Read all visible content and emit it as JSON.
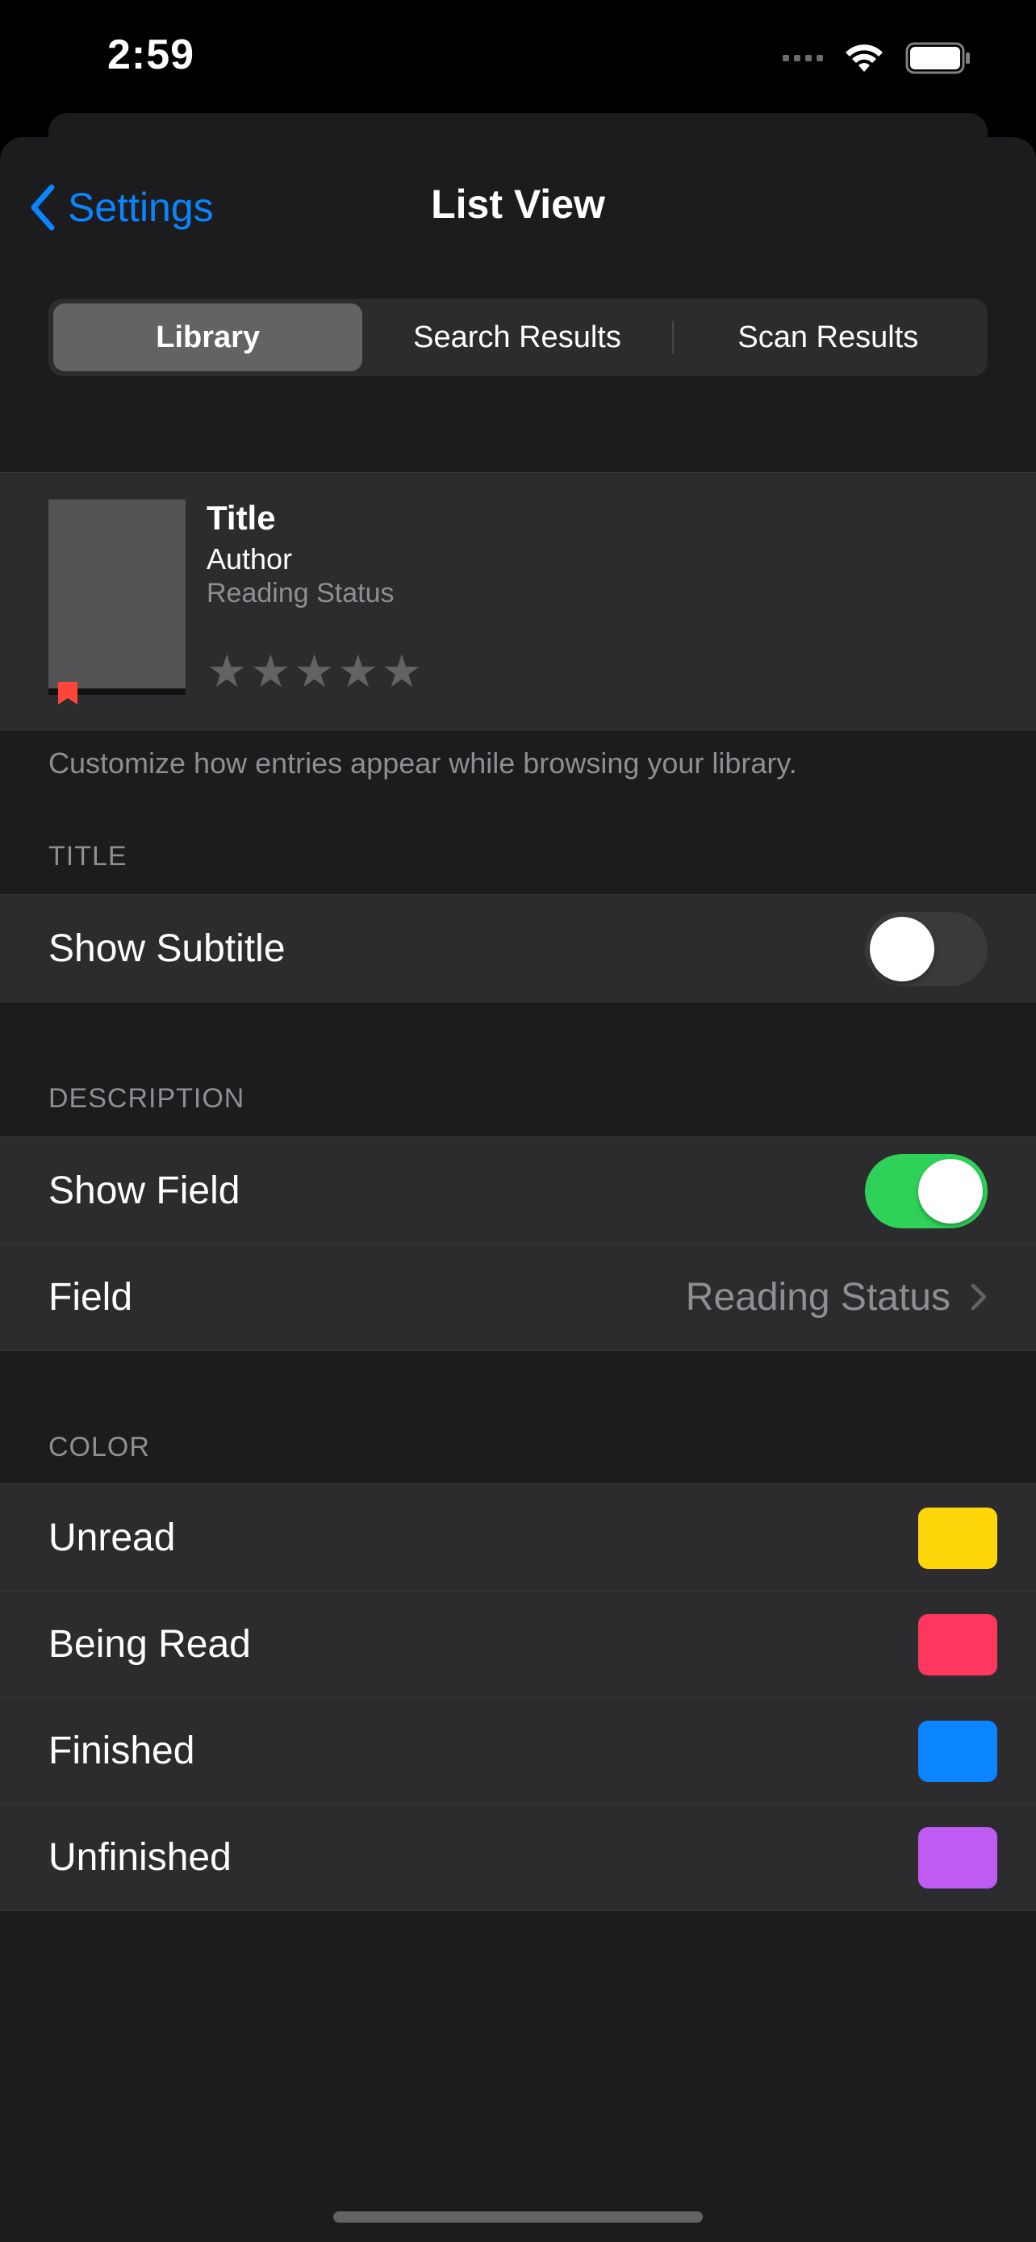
{
  "status_bar": {
    "time": "2:59"
  },
  "nav": {
    "back_label": "Settings",
    "title": "List View"
  },
  "segments": [
    "Library",
    "Search Results",
    "Scan Results"
  ],
  "selected_segment": "Library",
  "preview": {
    "title": "Title",
    "author": "Author",
    "status": "Reading Status",
    "rating_stars": 5,
    "bookmark_color": "#ff453a"
  },
  "footer_note": "Customize how entries appear while browsing your library.",
  "title_section": {
    "header": "TITLE",
    "show_subtitle_label": "Show Subtitle",
    "show_subtitle_on": false
  },
  "description_section": {
    "header": "DESCRIPTION",
    "show_field_label": "Show Field",
    "show_field_on": true,
    "field_label": "Field",
    "field_value": "Reading Status"
  },
  "color_section": {
    "header": "COLOR",
    "items": [
      {
        "label": "Unread",
        "color": "#ffd60a"
      },
      {
        "label": "Being Read",
        "color": "#ff375f"
      },
      {
        "label": "Finished",
        "color": "#0a84ff"
      },
      {
        "label": "Unfinished",
        "color": "#bf5af2"
      }
    ]
  },
  "colors": {
    "accent": "#0a84ff",
    "toggle_on": "#30d158",
    "background": "#1c1c1e"
  }
}
